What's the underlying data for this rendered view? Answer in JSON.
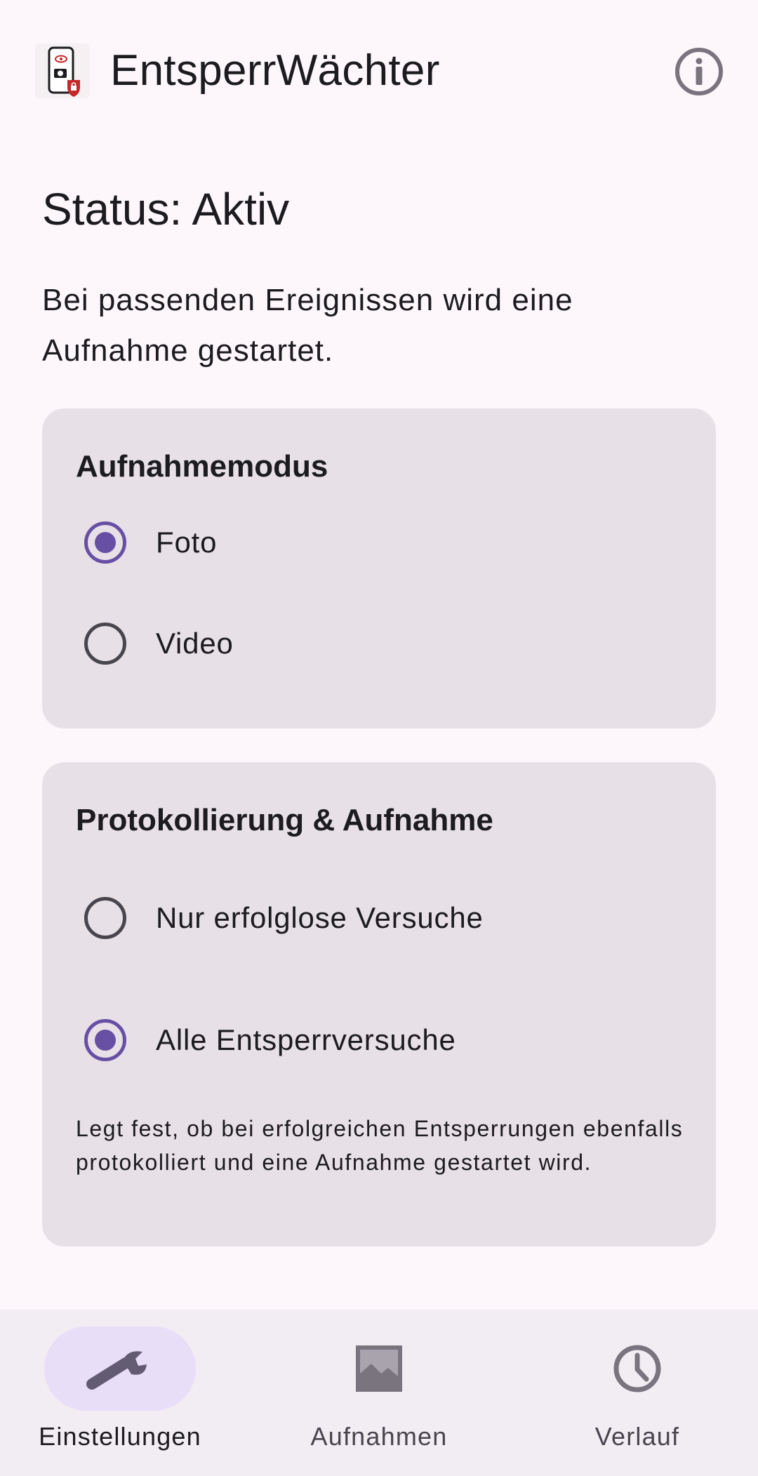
{
  "app": {
    "title": "EntsperrWächter",
    "logo_icon": "phone-lock-camera-icon",
    "info_icon": "info-icon"
  },
  "status": {
    "title": "Status: Aktiv",
    "description": "Bei passenden Ereignissen wird eine Aufnahme gestartet."
  },
  "capture_mode": {
    "title": "Aufnahmemodus",
    "options": [
      {
        "label": "Foto",
        "selected": true
      },
      {
        "label": "Video",
        "selected": false
      }
    ]
  },
  "logging": {
    "title": "Protokollierung & Aufnahme",
    "options": [
      {
        "label": "Nur erfolglose Versuche",
        "selected": false
      },
      {
        "label": "Alle Entsperrversuche",
        "selected": true
      }
    ],
    "helper": "Legt fest, ob bei erfolgreichen Entsperrungen ebenfalls protokolliert und eine Aufnahme gestartet wird."
  },
  "bottom_nav": {
    "items": [
      {
        "label": "Einstellungen",
        "icon": "wrench-icon",
        "active": true
      },
      {
        "label": "Aufnahmen",
        "icon": "image-icon",
        "active": false
      },
      {
        "label": "Verlauf",
        "icon": "clock-icon",
        "active": false
      }
    ]
  },
  "colors": {
    "accent": "#6750a4",
    "background": "#fdf7fc",
    "card": "#e7e0e6",
    "nav_background": "#f2ecf3",
    "active_pill": "#e8def8"
  }
}
